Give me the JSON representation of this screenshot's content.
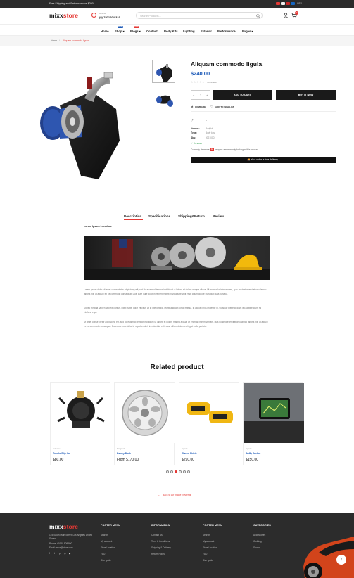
{
  "topbar": {
    "message": "Free Shipping and Returns above $200!",
    "currency": "USD"
  },
  "header": {
    "logo_main": "mixx",
    "logo_accent": "store",
    "hotline_label": "Hotline",
    "hotline_number": "(0)-7971604-321",
    "search_placeholder": "Search Products...",
    "cart_count": "0",
    "wishlist_count": "0"
  },
  "nav": {
    "items": [
      {
        "label": "Home"
      },
      {
        "label": "Shop",
        "badge": "NEW"
      },
      {
        "label": "Blogs",
        "badge": "HOT"
      },
      {
        "label": "Contact"
      },
      {
        "label": "Body Kits"
      },
      {
        "label": "Lighting"
      },
      {
        "label": "Exterior"
      },
      {
        "label": "Performance"
      },
      {
        "label": "Pages"
      }
    ]
  },
  "breadcrumb": {
    "home": "Home",
    "separator": "/",
    "current": "Aliquam commodo ligula"
  },
  "product": {
    "title": "Aliquam commodo ligula",
    "price": "$240.00",
    "reviews": "No reviews",
    "quantity": "1",
    "add_to_cart": "ADD TO CART",
    "buy_now": "BUY IT NOW",
    "compare": "COMPARE",
    "wishlist": "ADD TO WISHLIST",
    "vendor_label": "Vendor:",
    "vendor_value": "Bodykit",
    "type_label": "Type:",
    "type_value": "Body kits",
    "sku_label": "Sku:",
    "sku_value": "90210001",
    "stock": "In stock",
    "viewers_prefix": "Currently there are",
    "viewers_count": "28",
    "viewers_suffix": "peoples are currently looking at this product",
    "delivery": "Your order is free delivery !"
  },
  "tabs": {
    "items": [
      "Description",
      "Specifications",
      "Shipping&Return",
      "Review"
    ],
    "active": "Description",
    "content_title": "Lorem Ipsum Introduce",
    "paragraphs": [
      "Lorem ipsum dolor sit amet conse ctetur adipisicing elit, sed do eiusmod tempor incididunt ut labore et dolore magna aliqua. Ut enim ad minim veniam, quis nostrud exercitation ullamco laboris nisi ut aliquip ex ea commodo consequat. Duis aute irure dolor in reprehenderit in voluptate velit esse cillum dolore eu fugiat nulla pariatur.",
      "Donec fringilla sapien sed elit cursus, eget mattis dolor efficitur. Ut id libero nulla. Morbi aliquam tortor massa, in aliquet eros molestie in. Quisque eleifend diam leo, a bibendum mi eleifend eget.",
      "Ut amet conse ctetur adipisicing elit, sed do eiusmod tempor incididunt ut labore et dolore magna aliqua. Ut enim ad minim veniam, quis nostrud exercitation ullamco laboris nisi ut aliquip ex ea commodo consequat. Duis aute irure dolor in reprehenderit in voluptate velit esse cillum dolore eu fugiat nulla pariatur."
    ]
  },
  "related": {
    "heading": "Related product",
    "products": [
      {
        "category": "Exterior",
        "name": "Tussle Slip On",
        "price": "$80.00"
      },
      {
        "category": "Fragrant",
        "name": "Fanny Pack",
        "price": "From $170.00"
      },
      {
        "category": "Sports",
        "name": "Flared Skirts",
        "price": "$290.00"
      },
      {
        "category": "Sports",
        "name": "Puffy Jacket",
        "price": "$150.00"
      }
    ],
    "back_link": "Back to Air Intake Systems"
  },
  "footer": {
    "address": "123 South Main Street, Los Angeles United States",
    "phone": "Phone: +0160 808 800",
    "email": "Email: mixx@store.com",
    "columns": [
      {
        "title": "FOOTER MENU",
        "links": [
          "Search",
          "My account",
          "Store Location",
          "FAQ",
          "Size guide"
        ]
      },
      {
        "title": "INFORMATION",
        "links": [
          "Contact Us",
          "Term & Conditions",
          "Shipping & Delivery",
          "Return Policy"
        ]
      },
      {
        "title": "FOOTER MENU",
        "links": [
          "Search",
          "My account",
          "Store Location",
          "FAQ",
          "Size guide"
        ]
      },
      {
        "title": "CATEGORIES",
        "links": [
          "Accessories",
          "Clothing",
          "Shoes"
        ]
      }
    ]
  },
  "colors": {
    "accent": "#e53935",
    "price_blue": "#1e5bb8",
    "dark": "#1a1a1a",
    "footer_bg": "#2c2c2c"
  }
}
